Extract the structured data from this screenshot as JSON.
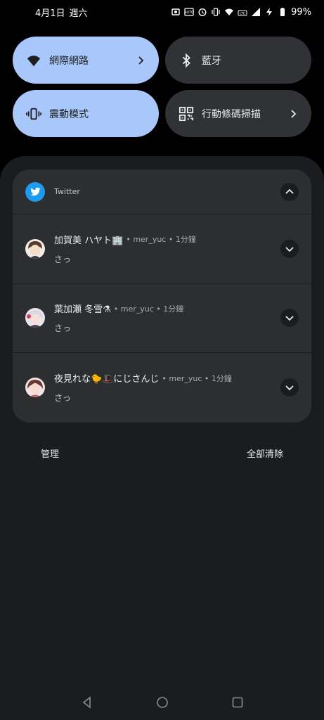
{
  "status_bar": {
    "date": "4月1日",
    "weekday": "週六",
    "battery": "99%",
    "icons": [
      "screenshot-icon",
      "auto-brightness-icon",
      "alarm-icon",
      "vibrate-icon",
      "wifi-icon",
      "volte-icon",
      "signal-icon",
      "charging-icon",
      "battery-icon"
    ]
  },
  "quick_settings": [
    {
      "label": "網際網路",
      "icon": "wifi-icon",
      "state": "on",
      "has_chevron": true
    },
    {
      "label": "藍牙",
      "icon": "bluetooth-icon",
      "state": "off",
      "has_chevron": false
    },
    {
      "label": "震動模式",
      "icon": "vibrate-icon",
      "state": "on",
      "has_chevron": false
    },
    {
      "label": "行動條碼掃描",
      "icon": "qr-scanner-icon",
      "state": "off",
      "has_chevron": true
    }
  ],
  "notification": {
    "app_name": "Twitter",
    "messages": [
      {
        "sender": "加賀美 ハヤト🏢",
        "meta": "• mer_yuc • 1分鐘",
        "text": "さっ"
      },
      {
        "sender": "葉加瀬 冬雪⚗",
        "meta": "• mer_yuc • 1分鐘",
        "text": "さっ"
      },
      {
        "sender": "夜見れな🐤🎩にじさんじ",
        "meta": "• mer_yuc • 1分鐘",
        "text": "さっ"
      }
    ]
  },
  "actions": {
    "manage": "管理",
    "clear_all": "全部清除"
  },
  "colors": {
    "tile_on": "#a8c7fa",
    "tile_off": "#303235",
    "twitter_blue": "#1d9bf0"
  }
}
